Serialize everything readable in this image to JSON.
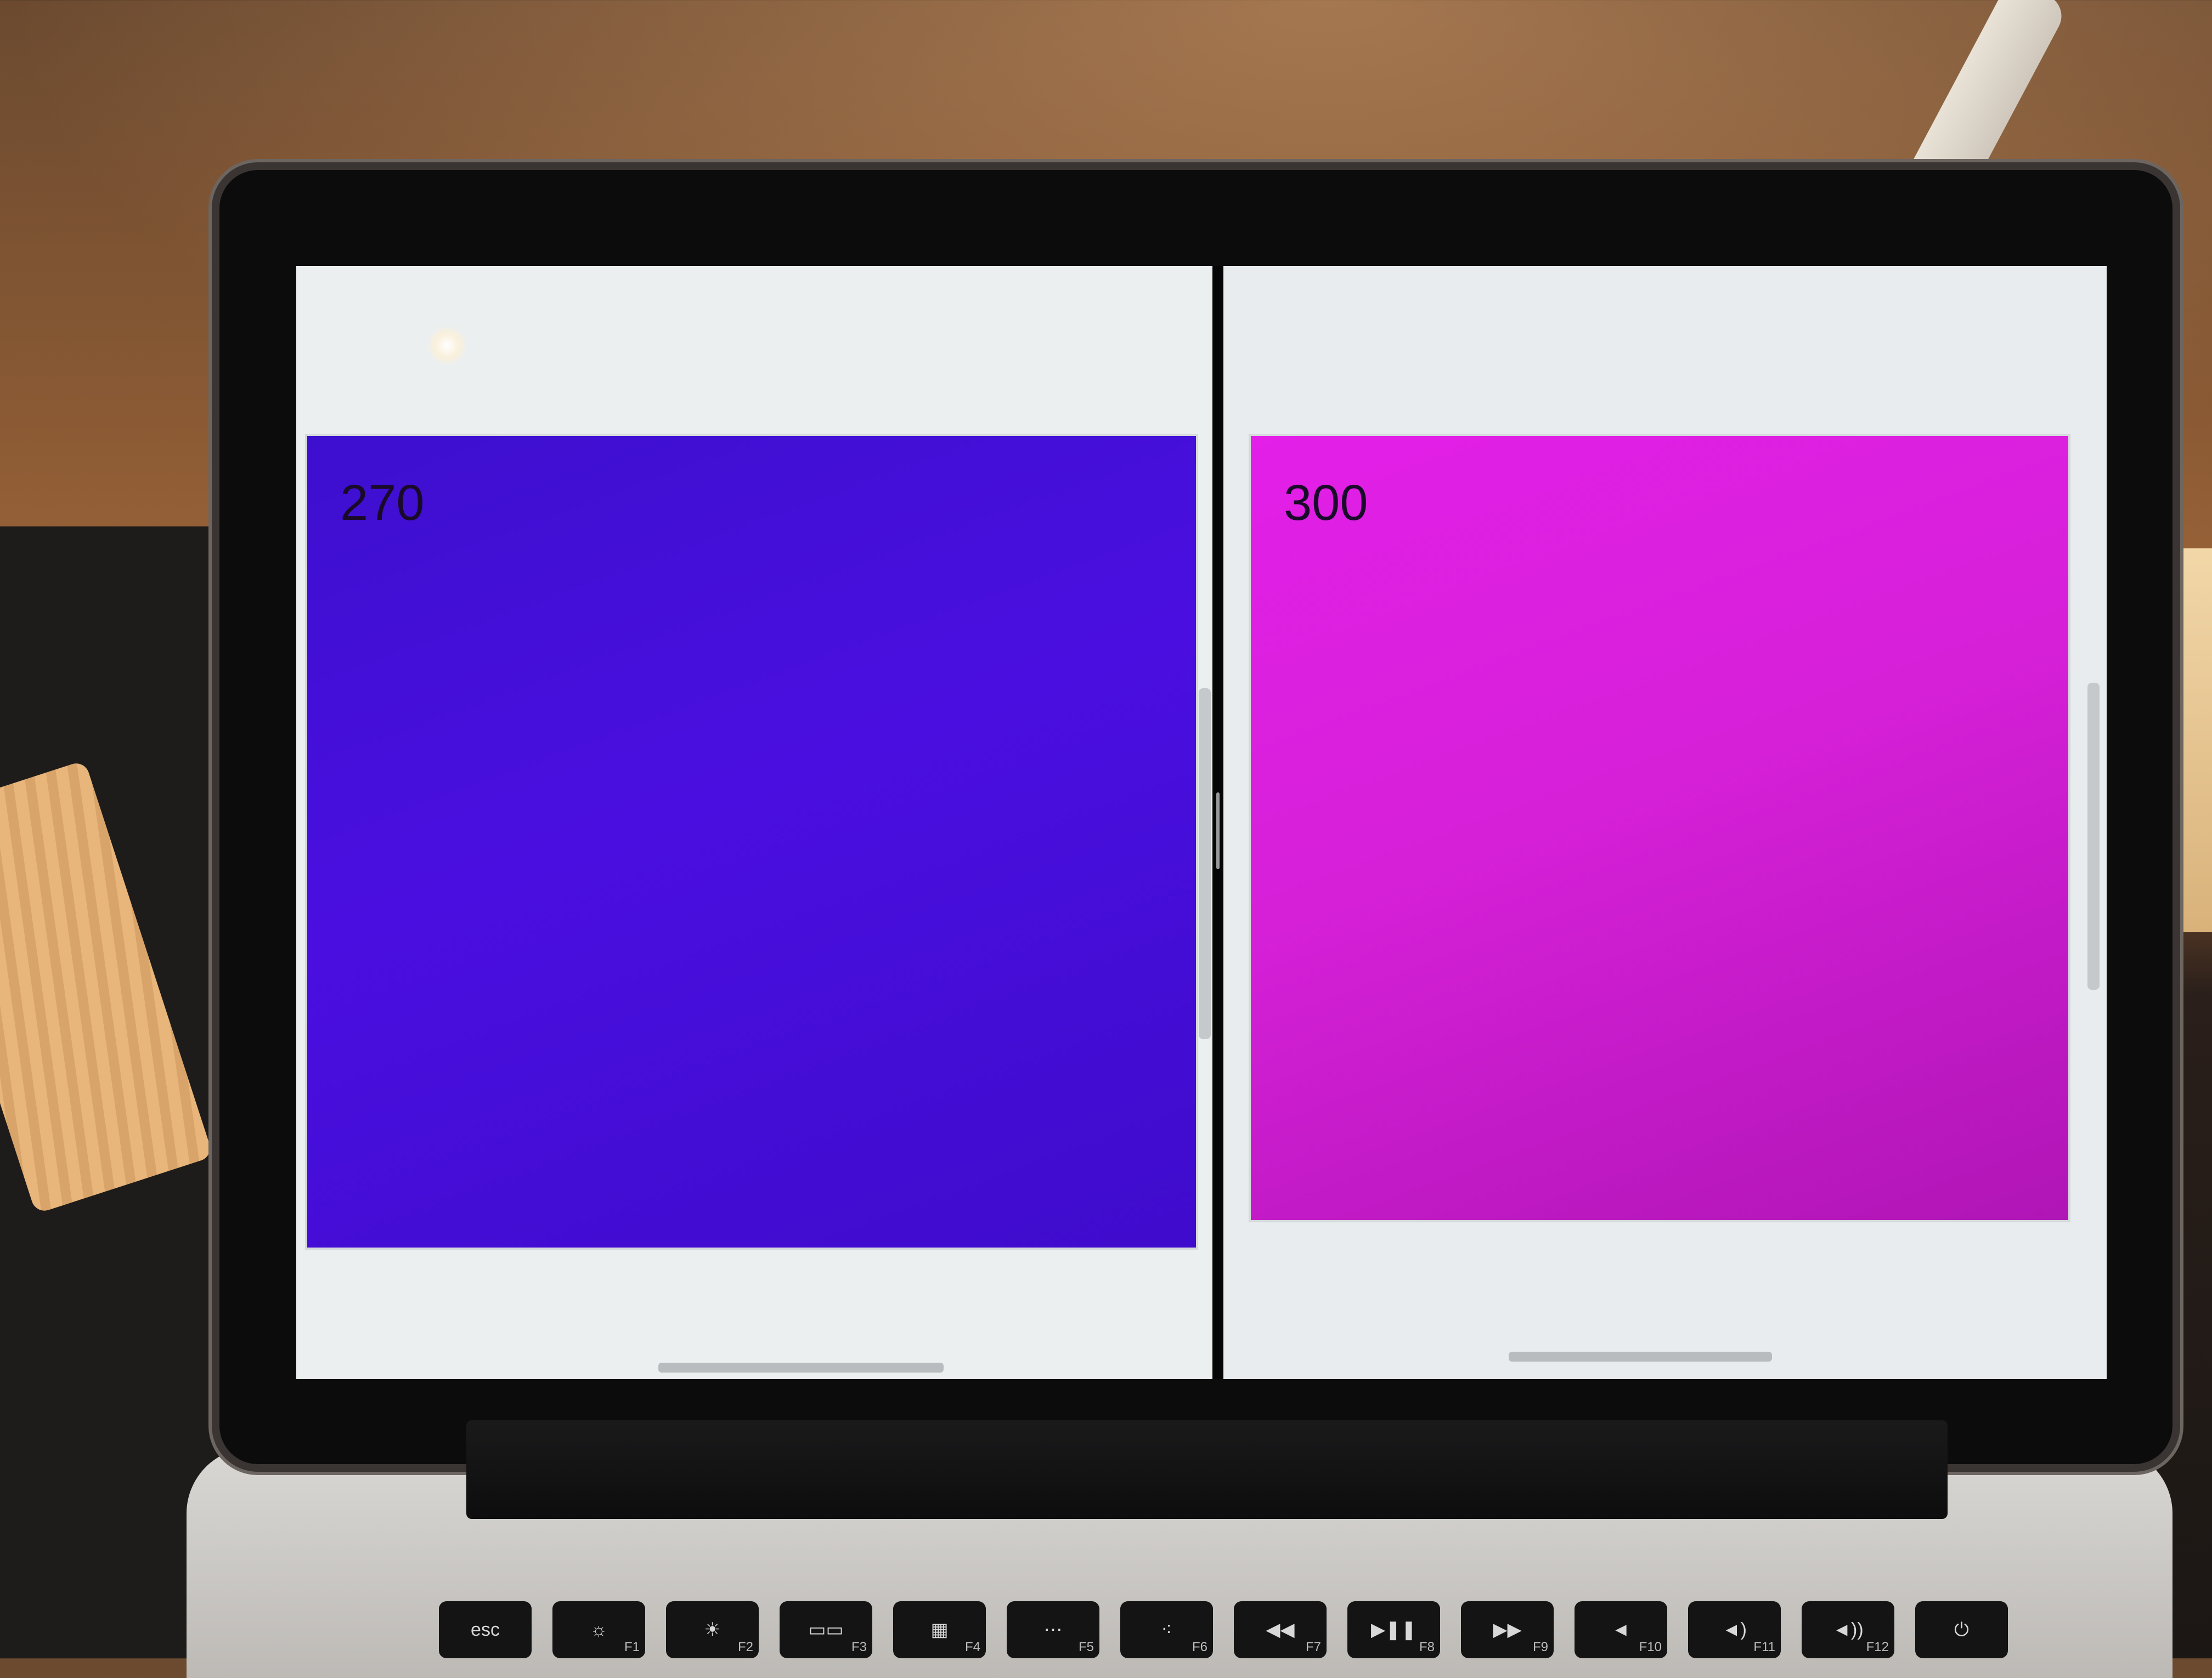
{
  "scene": {
    "description_colors": {
      "left_swatch": "#4a0fe0",
      "right_swatch": "#d620d8",
      "pane_background": "#eceff0"
    }
  },
  "left_pane": {
    "swatch_value": "270"
  },
  "right_pane": {
    "swatch_value": "300"
  },
  "keyboard": {
    "keys": [
      {
        "label": "esc",
        "fn": "",
        "icon": "esc-key"
      },
      {
        "label": "☼",
        "fn": "F1",
        "icon": "brightness-down-icon"
      },
      {
        "label": "☀",
        "fn": "F2",
        "icon": "brightness-up-icon"
      },
      {
        "label": "▭▭",
        "fn": "F3",
        "icon": "mission-control-icon"
      },
      {
        "label": "▦",
        "fn": "F4",
        "icon": "launchpad-icon"
      },
      {
        "label": "⋯",
        "fn": "F5",
        "icon": "keyboard-light-down-icon"
      },
      {
        "label": "⁖",
        "fn": "F6",
        "icon": "keyboard-light-up-icon"
      },
      {
        "label": "◀◀",
        "fn": "F7",
        "icon": "rewind-icon"
      },
      {
        "label": "▶❚❚",
        "fn": "F8",
        "icon": "play-pause-icon"
      },
      {
        "label": "▶▶",
        "fn": "F9",
        "icon": "fast-forward-icon"
      },
      {
        "label": "◄",
        "fn": "F10",
        "icon": "mute-icon"
      },
      {
        "label": "◄)",
        "fn": "F11",
        "icon": "volume-down-icon"
      },
      {
        "label": "◄))",
        "fn": "F12",
        "icon": "volume-up-icon"
      },
      {
        "label": "⏻",
        "fn": "",
        "icon": "power-icon"
      }
    ]
  }
}
